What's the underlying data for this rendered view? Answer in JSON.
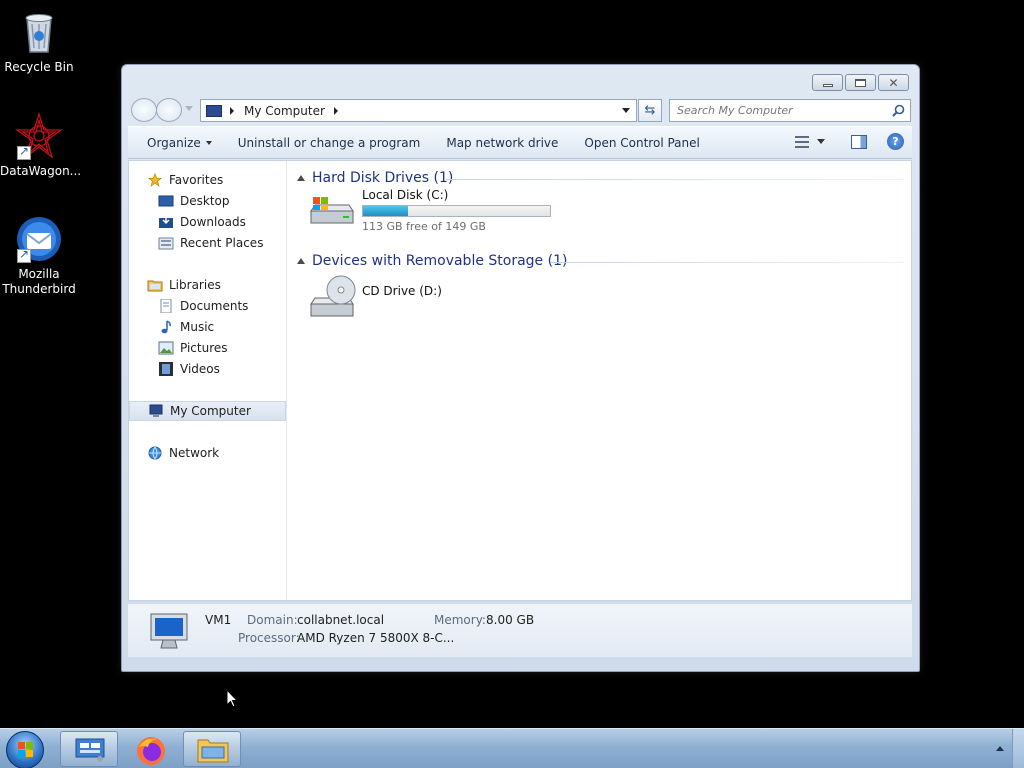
{
  "desktop": {
    "icons": [
      {
        "label": "Recycle Bin",
        "icon": "recycle-bin-icon"
      },
      {
        "label": "DataWagon...",
        "icon": "datawagon-icon"
      },
      {
        "label": "Mozilla Thunderbird",
        "icon": "thunderbird-icon"
      }
    ]
  },
  "window": {
    "address": {
      "crumbs": [
        "My Computer"
      ]
    },
    "search": {
      "placeholder": "Search My Computer"
    },
    "toolbar": {
      "organize": "Organize",
      "uninstall": "Uninstall or change a program",
      "map_drive": "Map network drive",
      "control_panel": "Open Control Panel"
    },
    "nav": {
      "favorites": "Favorites",
      "desktop": "Desktop",
      "downloads": "Downloads",
      "recent_places": "Recent Places",
      "libraries": "Libraries",
      "documents": "Documents",
      "music": "Music",
      "pictures": "Pictures",
      "videos": "Videos",
      "my_computer": "My Computer",
      "network": "Network"
    },
    "groups": {
      "hard_disk": "Hard Disk Drives (1)",
      "removable": "Devices with Removable Storage (1)"
    },
    "drives": {
      "local": {
        "label": "Local Disk (C:)",
        "free_text": "113 GB free of 149 GB",
        "used_fraction": 0.24
      },
      "cd": {
        "label": "CD Drive (D:)"
      }
    },
    "details": {
      "name": "VM1",
      "domain_label": "Domain:",
      "domain_value": "collabnet.local",
      "memory_label": "Memory:",
      "memory_value": "8.00 GB",
      "processor_label": "Processor:",
      "processor_value": "AMD Ryzen 7 5800X 8-C..."
    }
  },
  "colors": {
    "accent": "#1e3287",
    "taskbar": "#8fb0d3",
    "drive_fill": "#1f8fc1"
  }
}
